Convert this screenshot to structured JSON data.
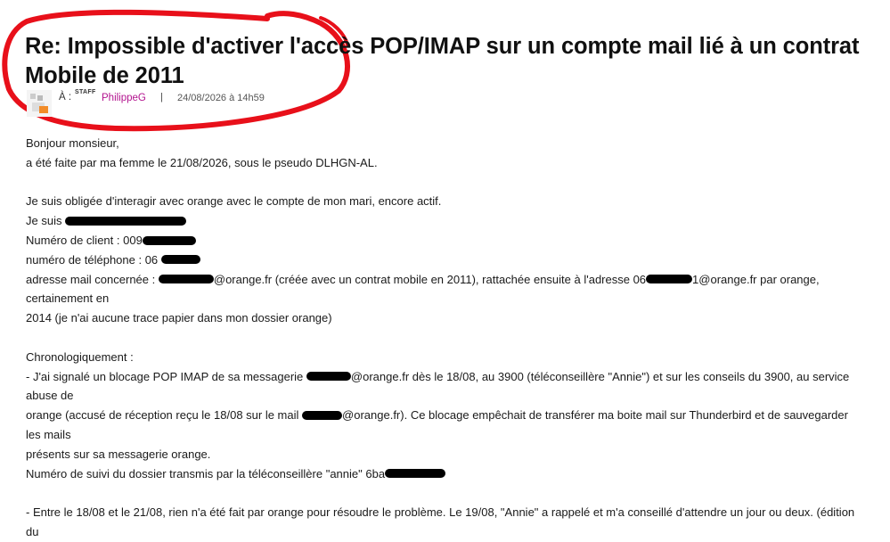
{
  "post": {
    "title": "Re: Impossible d'activer l'accès POP/IMAP sur un compte mail lié à un contrat Mobile de 2011",
    "to_label": "À :",
    "staff_badge": "STAFF",
    "author": "PhilippeG",
    "separator": "|",
    "date": "24/08/2026 à 14h59"
  },
  "body": {
    "greeting": "Bonjour monsieur,",
    "line1": "a été faite par ma femme le 21/08/2026, sous le pseudo DLHGN-AL.",
    "line2": "Je suis obligée d'interagir avec orange avec le compte de mon mari, encore actif.",
    "line3_prefix": "Je suis",
    "line4_prefix": "Numéro de client : 009",
    "line5_prefix": "numéro de téléphone : 06",
    "line6_prefix": "adresse mail concernée :",
    "line6_mid": "@orange.fr (créée avec un contrat mobile en 2011), rattachée ensuite à l'adresse 06",
    "line6_suffix": "1@orange.fr par orange, certainement en",
    "line7": "2014 (je n'ai aucune trace papier dans mon dossier orange)",
    "chrono_heading": "Chronologiquement :",
    "line8_prefix": "- J'ai signalé un blocage POP IMAP de sa messagerie",
    "line8_suffix": "@orange.fr dès le 18/08, au 3900 (téléconseillère \"Annie\") et sur les conseils du 3900, au service abuse de",
    "line9_prefix": "orange (accusé de réception reçu le 18/08 sur le mail",
    "line9_suffix": "@orange.fr). Ce blocage empêchait de transférer ma boite mail sur Thunderbird et de sauvegarder les mails",
    "line10": "présents sur sa messagerie orange.",
    "line11_prefix": "Numéro de suivi du dossier transmis par la téléconseillère \"annie\" 6ba",
    "line12": "- Entre le 18/08 et le 21/08, rien n'a été fait par orange pour résoudre le problème. Le 19/08, \"Annie\" a rappelé et m'a conseillé d'attendre un jour ou deux. (édition du"
  },
  "colors": {
    "author": "#b3148f",
    "annotation": "#e8101a",
    "redaction": "#000000"
  }
}
